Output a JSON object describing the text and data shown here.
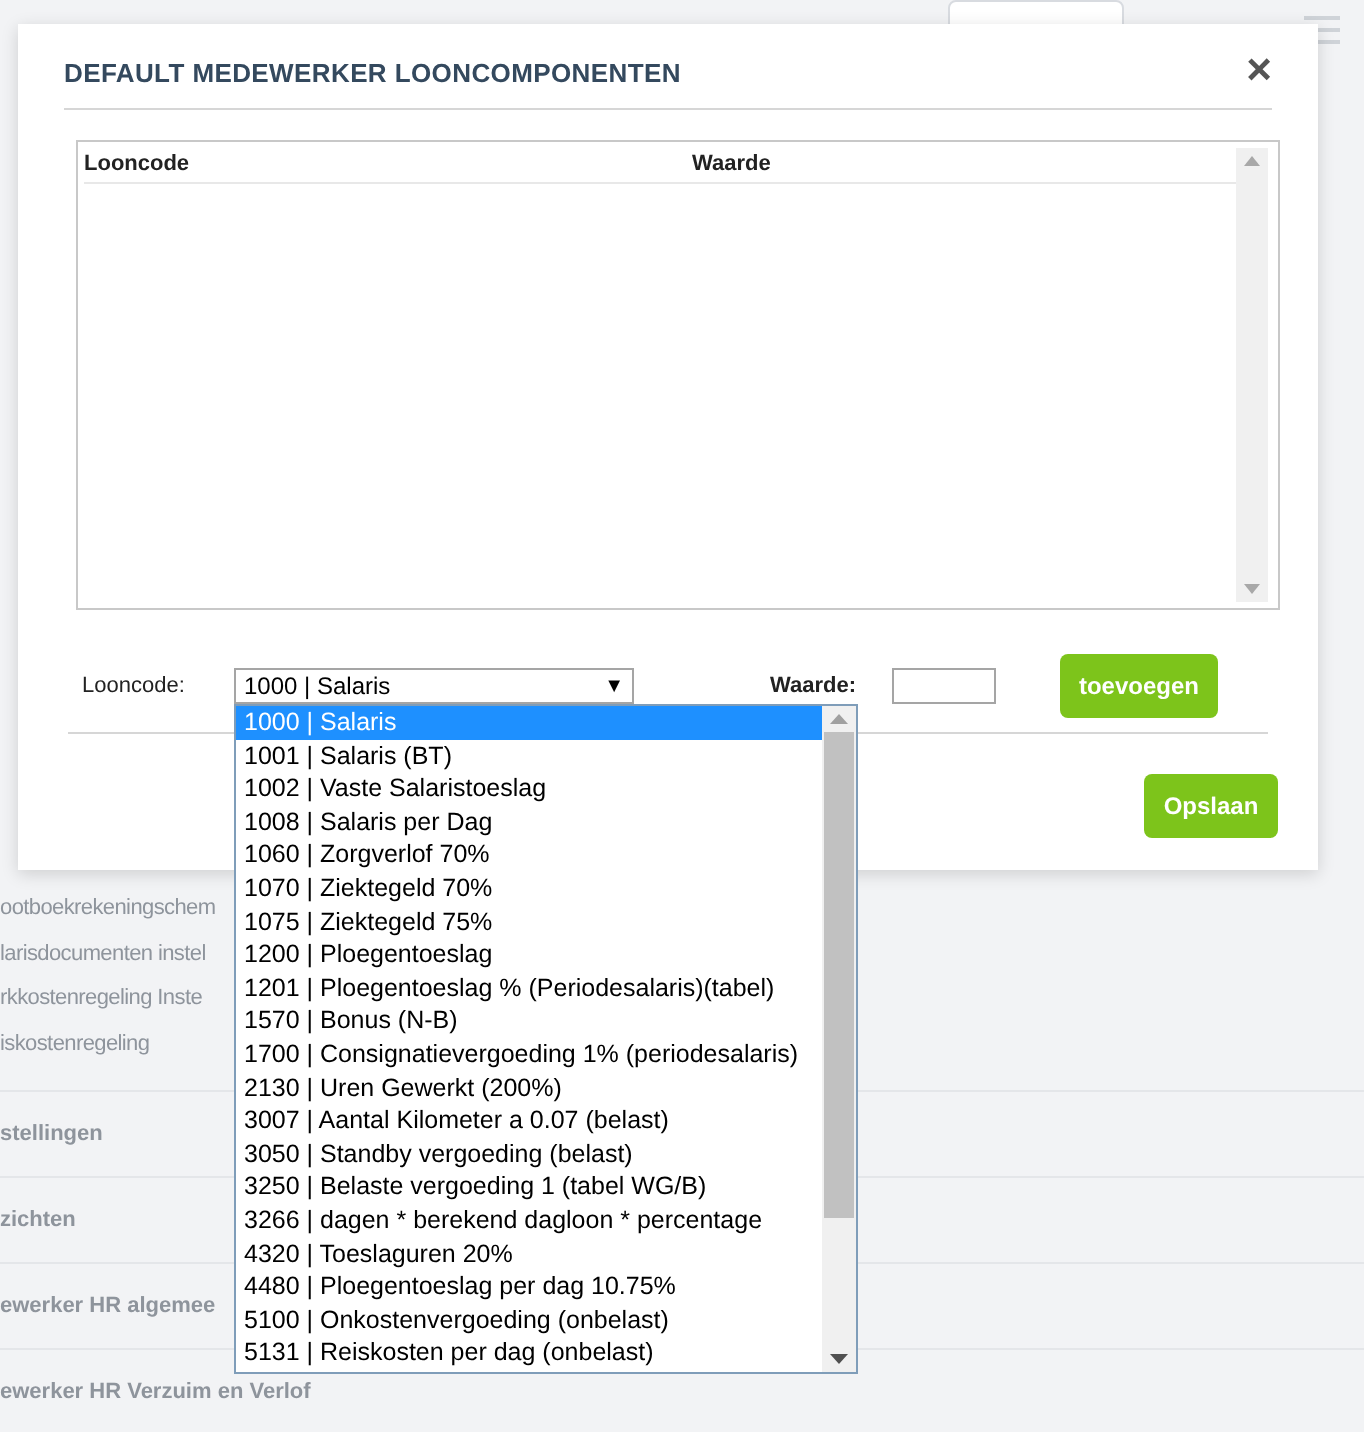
{
  "background": {
    "items": [
      "ootboekrekeningschem",
      "larisdocumenten instel",
      "rkkostenregeling Inste",
      "iskostenregeling"
    ],
    "sections": [
      "stellingen",
      "zichten",
      "ewerker HR algemee",
      "ewerker HR Verzuim en Verlof"
    ]
  },
  "dialog": {
    "title": "DEFAULT MEDEWERKER LOONCOMPONENTEN",
    "close": "×",
    "table": {
      "columns": [
        "Looncode",
        "Waarde"
      ]
    },
    "looncode_label": "Looncode:",
    "select_value": "1000 | Salaris",
    "select_arrow": "▼",
    "waarde_label": "Waarde:",
    "add_button": "toevoegen",
    "save_button": "Opslaan",
    "options": [
      {
        "label": "1000 | Salaris",
        "selected": true
      },
      {
        "label": "1001 | Salaris (BT)",
        "selected": false
      },
      {
        "label": "1002 | Vaste Salaristoeslag",
        "selected": false
      },
      {
        "label": "1008 | Salaris per Dag",
        "selected": false
      },
      {
        "label": "1060 | Zorgverlof 70%",
        "selected": false
      },
      {
        "label": "1070 | Ziektegeld 70%",
        "selected": false
      },
      {
        "label": "1075 | Ziektegeld 75%",
        "selected": false
      },
      {
        "label": "1200 | Ploegentoeslag",
        "selected": false
      },
      {
        "label": "1201 | Ploegentoeslag % (Periodesalaris)(tabel)",
        "selected": false
      },
      {
        "label": "1570 | Bonus (N-B)",
        "selected": false
      },
      {
        "label": "1700 | Consignatievergoeding 1% (periodesalaris)",
        "selected": false
      },
      {
        "label": "2130 | Uren Gewerkt (200%)",
        "selected": false
      },
      {
        "label": "3007 | Aantal Kilometer a 0.07 (belast)",
        "selected": false
      },
      {
        "label": "3050 | Standby vergoeding (belast)",
        "selected": false
      },
      {
        "label": "3250 | Belaste vergoeding 1 (tabel WG/B)",
        "selected": false
      },
      {
        "label": "3266 | dagen * berekend dagloon * percentage",
        "selected": false
      },
      {
        "label": "4320 | Toeslaguren 20%",
        "selected": false
      },
      {
        "label": "4480 | Ploegentoeslag per dag 10.75%",
        "selected": false
      },
      {
        "label": "5100 | Onkostenvergoeding (onbelast)",
        "selected": false
      },
      {
        "label": "5131 | Reiskosten per dag (onbelast)",
        "selected": false
      }
    ]
  }
}
